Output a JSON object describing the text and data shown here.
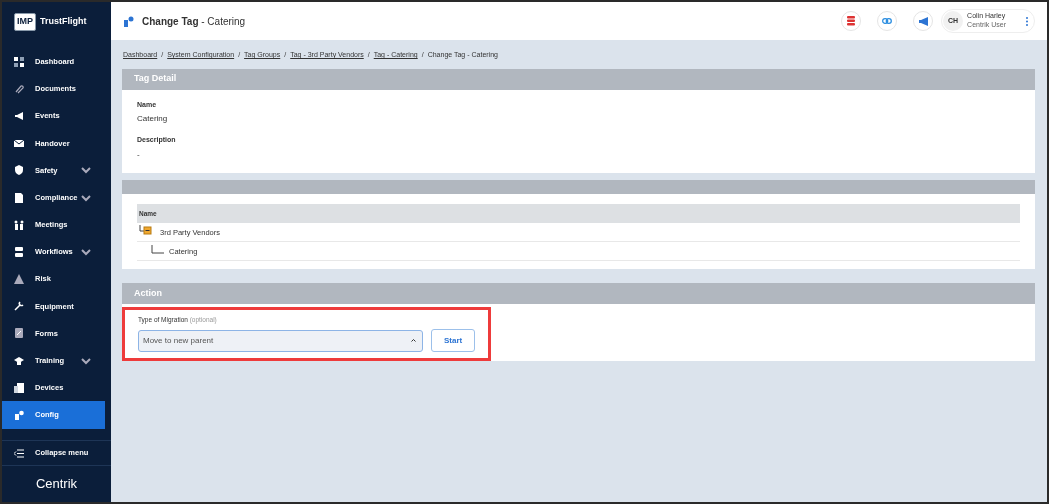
{
  "brand": {
    "badge": "IMP",
    "name": "TrustFlight"
  },
  "sidebar": {
    "items": [
      {
        "label": "Dashboard",
        "expandable": false,
        "selected": false
      },
      {
        "label": "Documents",
        "expandable": false,
        "selected": false
      },
      {
        "label": "Events",
        "expandable": false,
        "selected": false
      },
      {
        "label": "Handover",
        "expandable": false,
        "selected": false
      },
      {
        "label": "Safety",
        "expandable": true,
        "selected": false
      },
      {
        "label": "Compliance",
        "expandable": true,
        "selected": false
      },
      {
        "label": "Meetings",
        "expandable": false,
        "selected": false
      },
      {
        "label": "Workflows",
        "expandable": true,
        "selected": false
      },
      {
        "label": "Risk",
        "expandable": false,
        "selected": false
      },
      {
        "label": "Equipment",
        "expandable": false,
        "selected": false
      },
      {
        "label": "Forms",
        "expandable": false,
        "selected": false
      },
      {
        "label": "Training",
        "expandable": true,
        "selected": false
      },
      {
        "label": "Devices",
        "expandable": false,
        "selected": false
      },
      {
        "label": "Config",
        "expandable": false,
        "selected": true
      }
    ],
    "collapse": "Collapse menu",
    "footer_logo": "Centrik"
  },
  "header": {
    "title": "Change Tag",
    "subtitle": "- Catering",
    "user": {
      "initials": "CH",
      "name": "Colin Harley",
      "role": "Centrik User"
    }
  },
  "breadcrumb": {
    "separator": "/",
    "items": [
      "Dashboard",
      "System Configuration",
      "Tag Groups",
      "Tag - 3rd Party Vendors",
      "Tag - Catering",
      "Change Tag - Catering"
    ]
  },
  "tag_detail": {
    "title": "Tag Detail",
    "fields": [
      {
        "label": "Name",
        "value": "Catering"
      },
      {
        "label": "Description",
        "value": "-"
      }
    ]
  },
  "hierarchy": {
    "column": "Name",
    "tree": [
      {
        "label": "3rd Party Vendors",
        "expanded": true,
        "children": [
          {
            "label": "Catering"
          }
        ]
      }
    ]
  },
  "action": {
    "title": "Action",
    "field": {
      "label": "Type of Migration",
      "hint": "(optional)",
      "value": "Move to new parent"
    },
    "button": "Start"
  }
}
